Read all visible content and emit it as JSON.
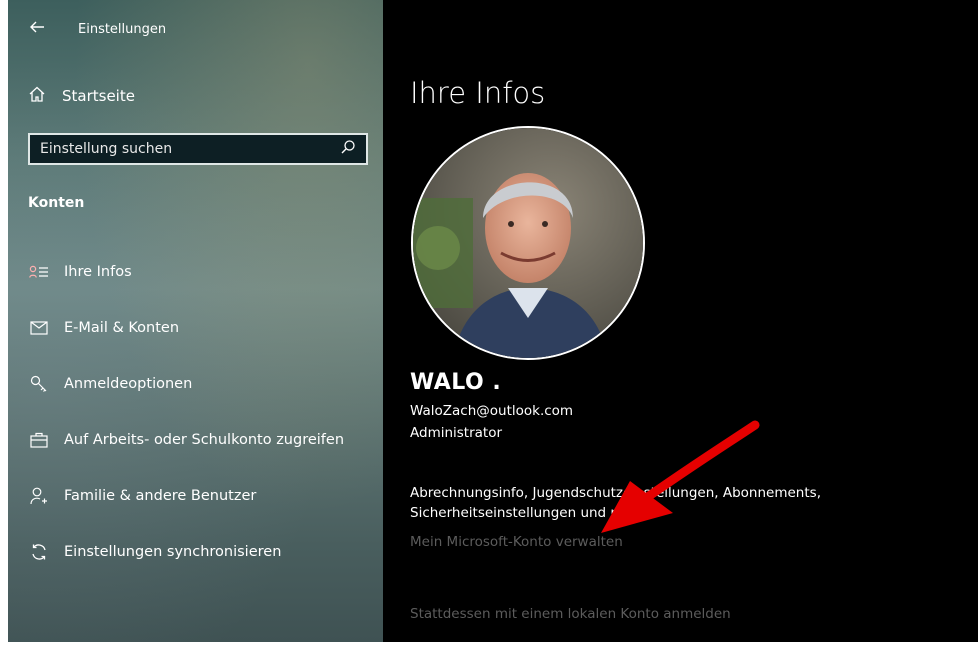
{
  "window": {
    "title": "Einstellungen"
  },
  "sidebar": {
    "home_label": "Startseite",
    "search": {
      "placeholder": "Einstellung suchen"
    },
    "section_title": "Konten",
    "items": [
      {
        "label": "Ihre Infos",
        "icon": "person-card-icon"
      },
      {
        "label": "E-Mail & Konten",
        "icon": "mail-icon"
      },
      {
        "label": "Anmeldeoptionen",
        "icon": "key-icon"
      },
      {
        "label": "Auf Arbeits- oder Schulkonto zugreifen",
        "icon": "briefcase-icon"
      },
      {
        "label": "Familie & andere Benutzer",
        "icon": "add-person-icon"
      },
      {
        "label": "Einstellungen synchronisieren",
        "icon": "sync-icon"
      }
    ]
  },
  "main": {
    "title": "Ihre Infos",
    "user": {
      "name": "WALO .",
      "email": "WaloZach@outlook.com",
      "role": "Administrator"
    },
    "info_text": "Abrechnungsinfo, Jugendschutzeinstellungen, Abonnements, Sicherheitseinstellungen und mehr",
    "manage_link": "Mein Microsoft-Konto verwalten",
    "local_link": "Stattdessen mit einem lokalen Konto anmelden"
  },
  "colors": {
    "accent_arrow": "#e50000",
    "sidebar_bg": "#5c7a77",
    "main_bg": "#000000",
    "link_dim": "#5c5c5c"
  }
}
